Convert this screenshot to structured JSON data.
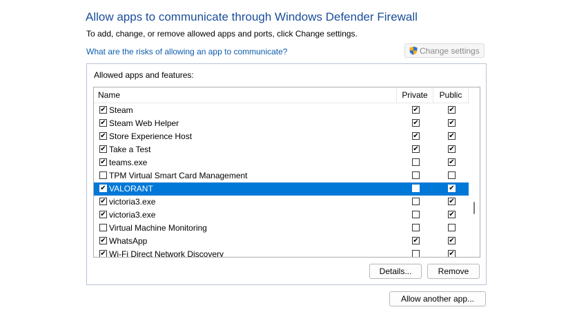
{
  "header": {
    "title": "Allow apps to communicate through Windows Defender Firewall",
    "subtitle": "To add, change, or remove allowed apps and ports, click Change settings.",
    "risk_link": "What are the risks of allowing an app to communicate?",
    "change_settings_label": "Change settings"
  },
  "group": {
    "label": "Allowed apps and features:"
  },
  "list": {
    "columns": {
      "name": "Name",
      "private": "Private",
      "public": "Public"
    },
    "rows": [
      {
        "name": "Steam",
        "enabled": true,
        "private": true,
        "public": true,
        "selected": false
      },
      {
        "name": "Steam Web Helper",
        "enabled": true,
        "private": true,
        "public": true,
        "selected": false
      },
      {
        "name": "Store Experience Host",
        "enabled": true,
        "private": true,
        "public": true,
        "selected": false
      },
      {
        "name": "Take a Test",
        "enabled": true,
        "private": true,
        "public": true,
        "selected": false
      },
      {
        "name": "teams.exe",
        "enabled": true,
        "private": false,
        "public": true,
        "selected": false
      },
      {
        "name": "TPM Virtual Smart Card Management",
        "enabled": false,
        "private": false,
        "public": false,
        "selected": false
      },
      {
        "name": "VALORANT",
        "enabled": true,
        "private": false,
        "public": true,
        "selected": true
      },
      {
        "name": "victoria3.exe",
        "enabled": true,
        "private": false,
        "public": true,
        "selected": false
      },
      {
        "name": "victoria3.exe",
        "enabled": true,
        "private": false,
        "public": true,
        "selected": false
      },
      {
        "name": "Virtual Machine Monitoring",
        "enabled": false,
        "private": false,
        "public": false,
        "selected": false
      },
      {
        "name": "WhatsApp",
        "enabled": true,
        "private": true,
        "public": true,
        "selected": false
      },
      {
        "name": "Wi-Fi Direct Network Discovery",
        "enabled": true,
        "private": false,
        "public": true,
        "selected": false
      }
    ]
  },
  "buttons": {
    "details": "Details...",
    "remove": "Remove",
    "allow_another": "Allow another app..."
  },
  "colors": {
    "title": "#1a4d99",
    "link": "#0b5cad",
    "selection": "#0078d7"
  },
  "icons": {
    "change_settings": "uac-shield-icon",
    "checkbox_checked": "checkmark"
  }
}
